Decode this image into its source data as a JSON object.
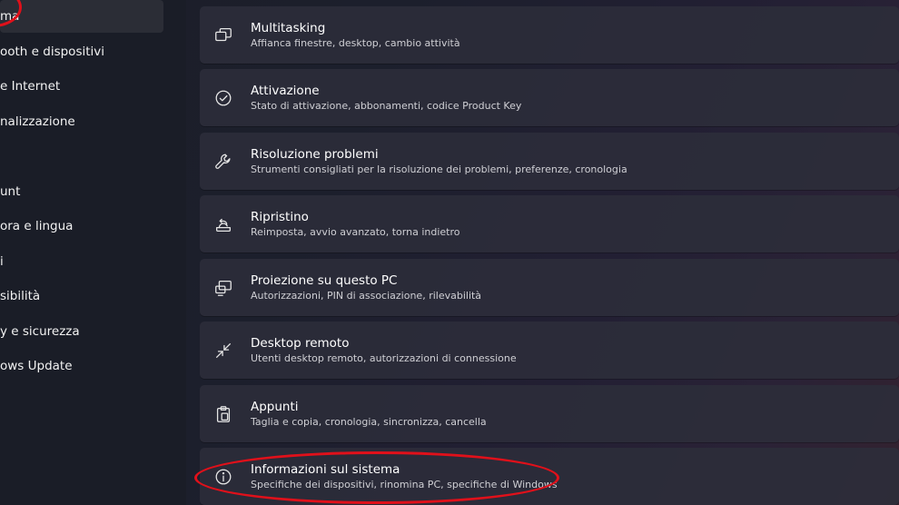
{
  "sidebar": {
    "items": [
      {
        "label": "ma"
      },
      {
        "label": "ooth e dispositivi"
      },
      {
        "label": "e Internet"
      },
      {
        "label": "nalizzazione"
      },
      {
        "label": ""
      },
      {
        "label": "unt"
      },
      {
        "label": "ora e lingua"
      },
      {
        "label": "i"
      },
      {
        "label": "sibilità"
      },
      {
        "label": "y e sicurezza"
      },
      {
        "label": "ows Update"
      }
    ]
  },
  "main": {
    "cards": [
      {
        "icon": "multitasking-icon",
        "title": "Multitasking",
        "subtitle": "Affianca finestre, desktop, cambio attività"
      },
      {
        "icon": "activation-icon",
        "title": "Attivazione",
        "subtitle": "Stato di attivazione, abbonamenti, codice Product Key"
      },
      {
        "icon": "troubleshoot-icon",
        "title": "Risoluzione problemi",
        "subtitle": "Strumenti consigliati per la risoluzione dei problemi, preferenze, cronologia"
      },
      {
        "icon": "recovery-icon",
        "title": "Ripristino",
        "subtitle": "Reimposta, avvio avanzato, torna indietro"
      },
      {
        "icon": "projection-icon",
        "title": "Proiezione su questo PC",
        "subtitle": "Autorizzazioni, PIN di associazione, rilevabilità"
      },
      {
        "icon": "remote-desktop-icon",
        "title": "Desktop remoto",
        "subtitle": "Utenti desktop remoto, autorizzazioni di connessione"
      },
      {
        "icon": "clipboard-icon",
        "title": "Appunti",
        "subtitle": "Taglia e copia, cronologia, sincronizza, cancella"
      },
      {
        "icon": "info-icon",
        "title": "Informazioni sul sistema",
        "subtitle": "Specifiche dei dispositivi, rinomina PC, specifiche di Windows"
      }
    ]
  },
  "annotations": {
    "highlight_color": "#e0101a"
  }
}
